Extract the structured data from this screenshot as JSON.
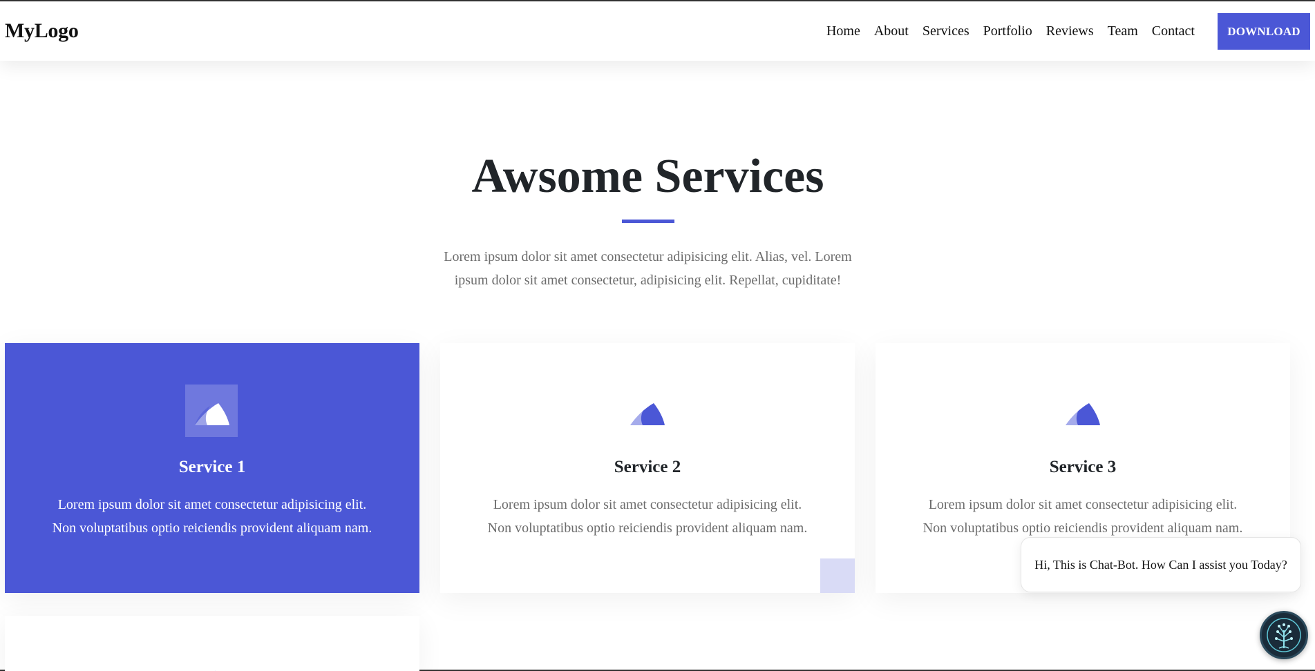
{
  "navbar": {
    "logo": "MyLogo",
    "links": [
      "Home",
      "About",
      "Services",
      "Portfolio",
      "Reviews",
      "Team",
      "Contact"
    ],
    "download_label": "DOWNLOAD"
  },
  "header": {
    "title": "Awsome Services",
    "description_line1": "Lorem ipsum dolor sit amet consectetur adipisicing elit. Alias, vel. Lorem",
    "description_line2": "ipsum dolor sit amet consectetur, adipisicing elit. Repellat, cupiditate!"
  },
  "services": [
    {
      "title": "Service 1",
      "line1": "Lorem ipsum dolor sit amet consectetur adipisicing elit.",
      "line2": "Non voluptatibus optio reiciendis provident aliquam nam.",
      "icon": "shark-fin-icon"
    },
    {
      "title": "Service 2",
      "line1": "Lorem ipsum dolor sit amet consectetur adipisicing elit.",
      "line2": "Non voluptatibus optio reiciendis provident aliquam nam.",
      "icon": "shark-fin-icon"
    },
    {
      "title": "Service 3",
      "line1": "Lorem ipsum dolor sit amet consectetur adipisicing elit.",
      "line2": "Non voluptatibus optio reiciendis provident aliquam nam.",
      "icon": "shark-fin-icon"
    }
  ],
  "chatbot": {
    "message": "Hi, This is Chat-Bot. How Can I assist you Today?",
    "icon": "chatbot-tree-icon"
  },
  "colors": {
    "accent": "#4b57d6",
    "accent_light": "#d9dbf6",
    "text_dark": "#212529",
    "text_muted": "#6c6c6c"
  }
}
